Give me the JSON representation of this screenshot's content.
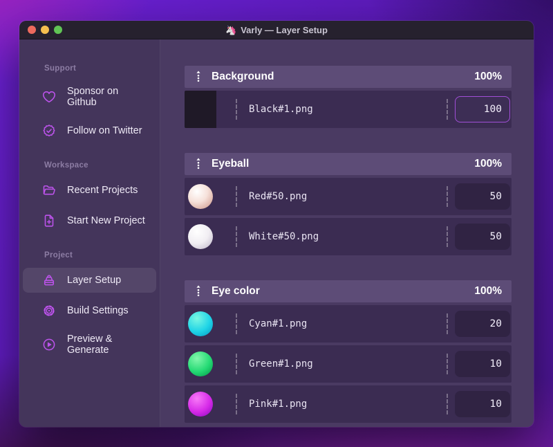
{
  "window": {
    "title": "Varly — Layer Setup",
    "app_emoji": "🦄",
    "traffic_lights": [
      "close",
      "minimize",
      "zoom"
    ]
  },
  "colors": {
    "accent_purple": "#bd53ec",
    "focus_border": "#a24fd8",
    "traffic_red": "#ed6a5e",
    "traffic_yellow": "#f5bf4f",
    "traffic_green": "#61c555"
  },
  "sidebar": {
    "sections": [
      {
        "label": "Support",
        "items": [
          {
            "icon": "heart-icon",
            "label": "Sponsor on Github"
          },
          {
            "icon": "check-badge-icon",
            "label": "Follow on Twitter"
          }
        ]
      },
      {
        "label": "Workspace",
        "items": [
          {
            "icon": "folder-open-icon",
            "label": "Recent Projects"
          },
          {
            "icon": "document-plus-icon",
            "label": "Start New Project"
          }
        ]
      },
      {
        "label": "Project",
        "items": [
          {
            "icon": "archive-box-icon",
            "label": "Layer Setup",
            "selected": true
          },
          {
            "icon": "gear-icon",
            "label": "Build Settings"
          },
          {
            "icon": "play-circle-icon",
            "label": "Preview & Generate"
          }
        ]
      }
    ]
  },
  "layers": {
    "groups": [
      {
        "name": "Background",
        "weight": "100%",
        "items": [
          {
            "file": "Black#1.png",
            "value": "100",
            "thumb": "black-square",
            "focused": true
          }
        ]
      },
      {
        "name": "Eyeball",
        "weight": "100%",
        "items": [
          {
            "file": "Red#50.png",
            "value": "50",
            "thumb": "red-ball"
          },
          {
            "file": "White#50.png",
            "value": "50",
            "thumb": "white-ball"
          }
        ]
      },
      {
        "name": "Eye color",
        "weight": "100%",
        "items": [
          {
            "file": "Cyan#1.png",
            "value": "20",
            "thumb": "cyan-ball"
          },
          {
            "file": "Green#1.png",
            "value": "10",
            "thumb": "green-ball"
          },
          {
            "file": "Pink#1.png",
            "value": "10",
            "thumb": "pink-ball"
          }
        ]
      }
    ]
  }
}
